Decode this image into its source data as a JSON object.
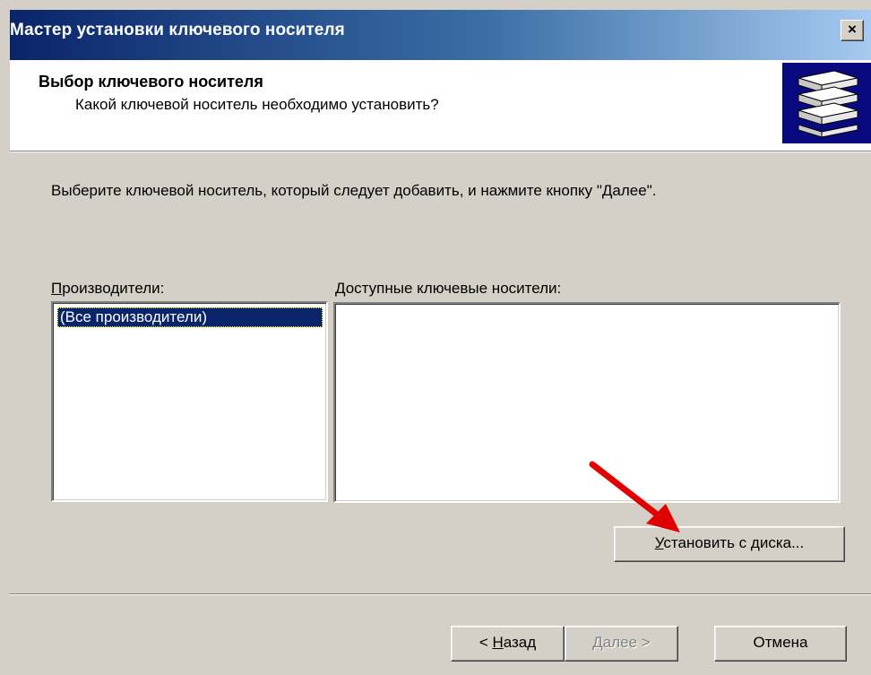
{
  "window": {
    "title": "Мастер установки ключевого носителя",
    "close_label": "×"
  },
  "header": {
    "title": "Выбор ключевого носителя",
    "subtitle": "Какой ключевой носитель необходимо установить?",
    "icon": "storage-stack-icon"
  },
  "instruction": "Выберите ключевой носитель, который следует добавить, и нажмите кнопку \"Далее\".",
  "manufacturers": {
    "label_first": "П",
    "label_rest": "роизводители:",
    "items": [
      {
        "label": "(Все производители)",
        "selected": true
      }
    ]
  },
  "available": {
    "label_first": "Д",
    "label_rest": "оступные ключевые носители:",
    "items": []
  },
  "buttons": {
    "install_first": "У",
    "install_rest": "становить с диска...",
    "back_prefix": "< ",
    "back_first": "Н",
    "back_rest": "азад",
    "next_first": "Д",
    "next_rest": "алее >",
    "cancel": "Отмена"
  },
  "colors": {
    "title_bar_start": "#0a246a",
    "title_bar_end": "#a6caf0",
    "selection": "#0a246a",
    "annotation_arrow": "#e00000"
  }
}
